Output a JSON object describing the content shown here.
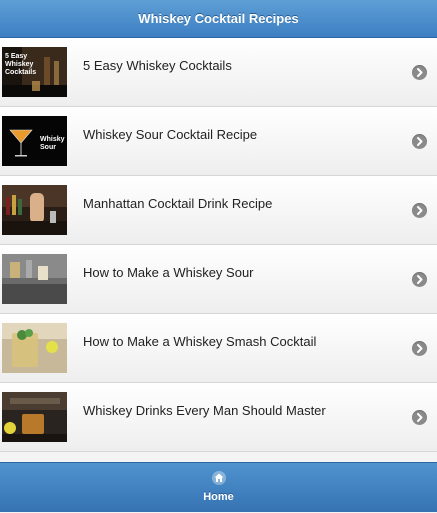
{
  "header": {
    "title": "Whiskey Cocktail Recipes"
  },
  "items": [
    {
      "title": "5 Easy Whiskey Cocktails",
      "thumb_text": "5 Easy Whiskey Cocktails",
      "thumb_icon": "cocktail-bar-thumbnail"
    },
    {
      "title": "Whiskey Sour Cocktail Recipe",
      "thumb_text": "Whisky Sour",
      "thumb_icon": "martini-glass-thumbnail"
    },
    {
      "title": "Manhattan Cocktail Drink Recipe",
      "thumb_text": "",
      "thumb_icon": "bartender-thumbnail"
    },
    {
      "title": "How to Make a Whiskey Sour",
      "thumb_text": "",
      "thumb_icon": "bar-counter-thumbnail"
    },
    {
      "title": "How to Make a Whiskey Smash Cocktail",
      "thumb_text": "",
      "thumb_icon": "mint-glass-thumbnail"
    },
    {
      "title": "Whiskey Drinks Every Man Should Master",
      "thumb_text": "",
      "thumb_icon": "whiskey-glass-thumbnail"
    }
  ],
  "footer": {
    "home_label": "Home",
    "home_icon": "home-icon"
  },
  "colors": {
    "header": "#4a8fd0",
    "footer": "#3f7fbf",
    "chevron": "#8a8a8a"
  }
}
